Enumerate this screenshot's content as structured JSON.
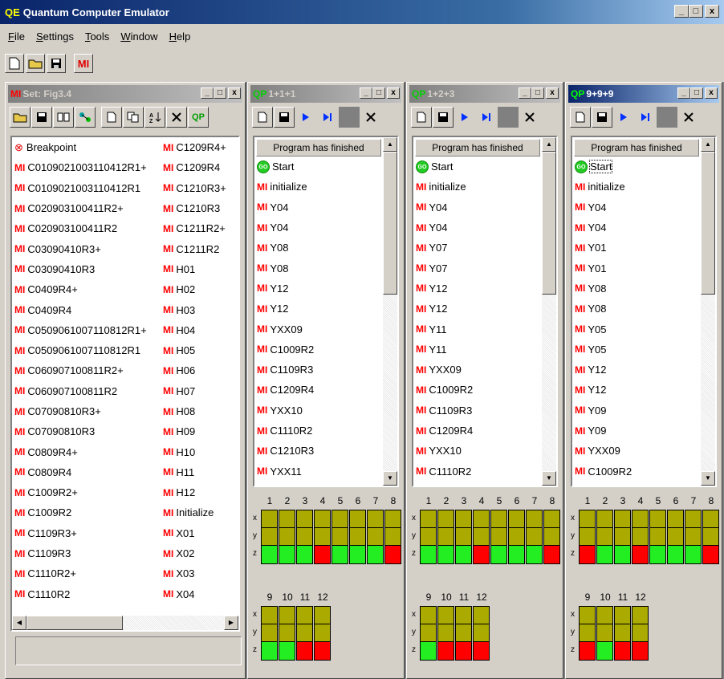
{
  "app": {
    "logo": "QE",
    "title": "Quantum Computer Emulator"
  },
  "window_buttons": [
    "_",
    "□",
    "x"
  ],
  "menu": [
    "File",
    "Settings",
    "Tools",
    "Window",
    "Help"
  ],
  "main_toolbar": {
    "new": "new-file-icon",
    "open": "open-folder-icon",
    "save": "save-disk-icon",
    "mi": "MI"
  },
  "set_window": {
    "logo": "MI",
    "title": "Set: Fig3.4",
    "toolbar_qp": "QP",
    "col1": [
      "Breakpoint",
      "C0109021003110412R1+",
      "C0109021003110412R1",
      "C020903100411R2+",
      "C020903100411R2",
      "C03090410R3+",
      "C03090410R3",
      "C0409R4+",
      "C0409R4",
      "C0509061007110812R1+",
      "C0509061007110812R1",
      "C060907100811R2+",
      "C060907100811R2",
      "C07090810R3+",
      "C07090810R3",
      "C0809R4+",
      "C0809R4",
      "C1009R2+",
      "C1009R2",
      "C1109R3+",
      "C1109R3",
      "C1110R2+",
      "C1110R2"
    ],
    "col2": [
      "C1209R4+",
      "C1209R4",
      "C1210R3+",
      "C1210R3",
      "C1211R2+",
      "C1211R2",
      "H01",
      "H02",
      "H03",
      "H04",
      "H05",
      "H06",
      "H07",
      "H08",
      "H09",
      "H10",
      "H11",
      "H12",
      "Initialize",
      "X01",
      "X02",
      "X03",
      "X04"
    ],
    "mi_label": "MI"
  },
  "programs": [
    {
      "logo": "QP",
      "title": "1+1+1",
      "active": false,
      "status": "Program has finished",
      "items": [
        "Start",
        "initialize",
        "Y04",
        "Y04",
        "Y08",
        "Y08",
        "Y12",
        "Y12",
        "YXX09",
        "C1009R2",
        "C1109R3",
        "C1209R4",
        "YXX10",
        "C1110R2",
        "C1210R3",
        "YXX11"
      ],
      "z_top": [
        "green",
        "green",
        "green",
        "red",
        "green",
        "green",
        "green",
        "red"
      ],
      "z_bottom": [
        "green",
        "green",
        "red",
        "red"
      ]
    },
    {
      "logo": "QP",
      "title": "1+2+3",
      "active": false,
      "status": "Program has finished",
      "items": [
        "Start",
        "initialize",
        "Y04",
        "Y04",
        "Y07",
        "Y07",
        "Y12",
        "Y12",
        "Y11",
        "Y11",
        "YXX09",
        "C1009R2",
        "C1109R3",
        "C1209R4",
        "YXX10",
        "C1110R2"
      ],
      "z_top": [
        "green",
        "green",
        "green",
        "red",
        "green",
        "green",
        "green",
        "red"
      ],
      "z_bottom": [
        "green",
        "red",
        "red",
        "red"
      ]
    },
    {
      "logo": "QP",
      "title": "9+9+9",
      "active": true,
      "status": "Program has finished",
      "items": [
        "Start",
        "initialize",
        "Y04",
        "Y04",
        "Y01",
        "Y01",
        "Y08",
        "Y08",
        "Y05",
        "Y05",
        "Y12",
        "Y12",
        "Y09",
        "Y09",
        "YXX09",
        "C1009R2"
      ],
      "z_top": [
        "red",
        "green",
        "green",
        "red",
        "green",
        "green",
        "green",
        "red"
      ],
      "z_bottom": [
        "red",
        "green",
        "red",
        "red"
      ]
    }
  ],
  "qubit_numbers_top": [
    "1",
    "2",
    "3",
    "4",
    "5",
    "6",
    "7",
    "8"
  ],
  "qubit_numbers_bottom": [
    "9",
    "10",
    "11",
    "12"
  ],
  "qubit_axes": [
    "x",
    "y",
    "z"
  ],
  "go_icon_text": "GO",
  "colors": {
    "red": "#ff0000",
    "green": "#22ee22",
    "olive": "#aaaa00",
    "mi": "#e00000"
  }
}
